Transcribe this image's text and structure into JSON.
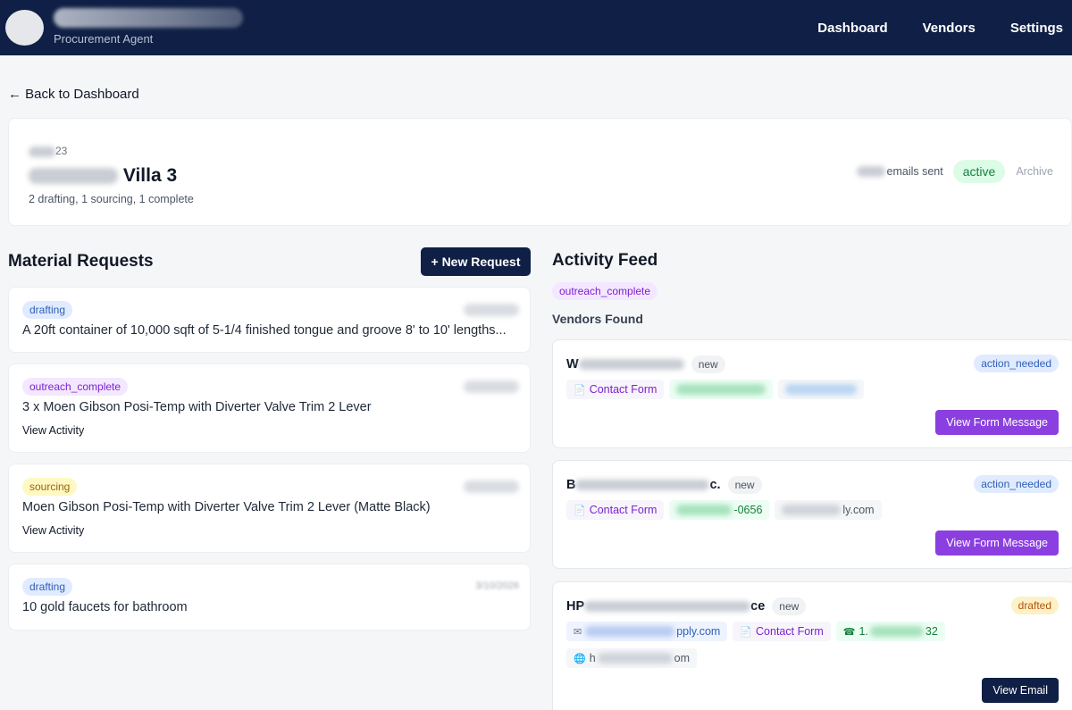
{
  "header": {
    "subtitle": "Procurement Agent",
    "nav": [
      "Dashboard",
      "Vendors",
      "Settings"
    ]
  },
  "back_link": "← Back to Dashboard",
  "project": {
    "code_suffix": "23",
    "title_suffix": "Villa 3",
    "summary": "2 drafting, 1 sourcing, 1 complete",
    "emails_sent_label": "emails sent",
    "status": "active",
    "archive_label": "Archive"
  },
  "material_requests": {
    "title": "Material Requests",
    "new_button": "+ New Request",
    "items": [
      {
        "status": "drafting",
        "text": "A 20ft container of 10,000 sqft of 5-1/4 finished tongue and groove 8' to 10' lengths...",
        "link": ""
      },
      {
        "status": "outreach_complete",
        "text": "3 x Moen Gibson Posi-Temp with Diverter Valve Trim 2 Lever",
        "link": "View Activity"
      },
      {
        "status": "sourcing",
        "text": "Moen Gibson Posi-Temp with Diverter Valve Trim 2 Lever (Matte Black)",
        "link": "View Activity"
      },
      {
        "status": "drafting",
        "text": "10 gold faucets for bathroom",
        "link": "",
        "date": "3/10/2026"
      }
    ]
  },
  "activity_feed": {
    "title": "Activity Feed",
    "status": "outreach_complete",
    "vendors_found_label": "Vendors Found",
    "vendors": [
      {
        "name_prefix": "W",
        "name_suffix": "",
        "tag": "new",
        "status": "action_needed",
        "contacts": {
          "form": "Contact Form"
        },
        "button": "View Form Message"
      },
      {
        "name_prefix": "B",
        "name_suffix": "c.",
        "tag": "new",
        "status": "action_needed",
        "contacts": {
          "form": "Contact Form",
          "phone_suffix": "-0656",
          "web_suffix": "ly.com"
        },
        "button": "View Form Message"
      },
      {
        "name_prefix": "HP",
        "name_suffix": "ce",
        "tag": "new",
        "status": "drafted",
        "contacts": {
          "email_suffix": "pply.com",
          "form": "Contact Form",
          "phone_prefix": "1.",
          "phone_suffix": "32",
          "web_prefix": "h",
          "web_suffix": "om"
        },
        "button": "View Email"
      }
    ]
  },
  "colors": {
    "header_bg": "#0f1f45",
    "accent_purple": "#8b3fe0",
    "active_green": "#15803d"
  }
}
